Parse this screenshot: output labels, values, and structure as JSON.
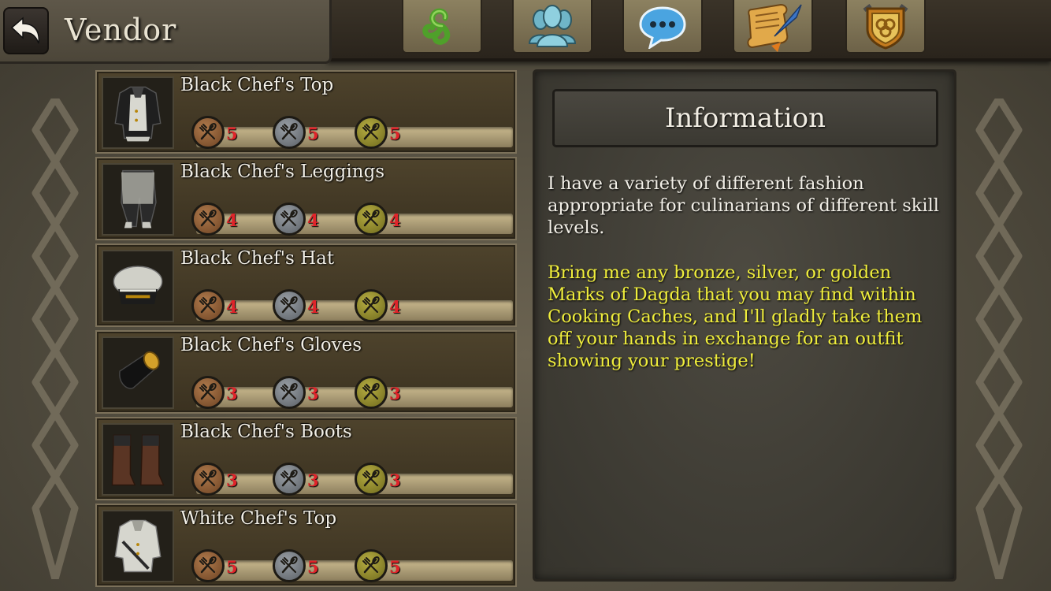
{
  "header": {
    "title": "Vendor",
    "nav_icons": [
      "triskele-icon",
      "group-icon",
      "chat-icon",
      "quest-scroll-icon",
      "guild-crest-icon"
    ]
  },
  "items": [
    {
      "name": "Black Chef's Top",
      "costs": {
        "bronze": "5",
        "silver": "5",
        "gold": "5"
      },
      "icon": "chef-top-black-icon"
    },
    {
      "name": "Black Chef's Leggings",
      "costs": {
        "bronze": "4",
        "silver": "4",
        "gold": "4"
      },
      "icon": "chef-leggings-black-icon"
    },
    {
      "name": "Black Chef's Hat",
      "costs": {
        "bronze": "4",
        "silver": "4",
        "gold": "4"
      },
      "icon": "chef-hat-black-icon"
    },
    {
      "name": "Black Chef's Gloves",
      "costs": {
        "bronze": "3",
        "silver": "3",
        "gold": "3"
      },
      "icon": "chef-gloves-black-icon"
    },
    {
      "name": "Black Chef's Boots",
      "costs": {
        "bronze": "3",
        "silver": "3",
        "gold": "3"
      },
      "icon": "chef-boots-black-icon"
    },
    {
      "name": "White Chef's Top",
      "costs": {
        "bronze": "5",
        "silver": "5",
        "gold": "5"
      },
      "icon": "chef-top-white-icon"
    }
  ],
  "info": {
    "title": "Information",
    "description": "I have a variety of different fashion appropriate for culinarians of different skill levels.",
    "highlight": "Bring me any bronze, silver, or golden Marks of Dagda that you may find within Cooking Caches, and I'll gladly take them off your hands in exchange for an outfit showing your prestige!"
  },
  "colors": {
    "cost_text": "#e0242a",
    "highlight_text": "#f0ee3c",
    "bronze": "#8f5a34",
    "silver": "#7a7f85",
    "gold": "#948c2e"
  }
}
